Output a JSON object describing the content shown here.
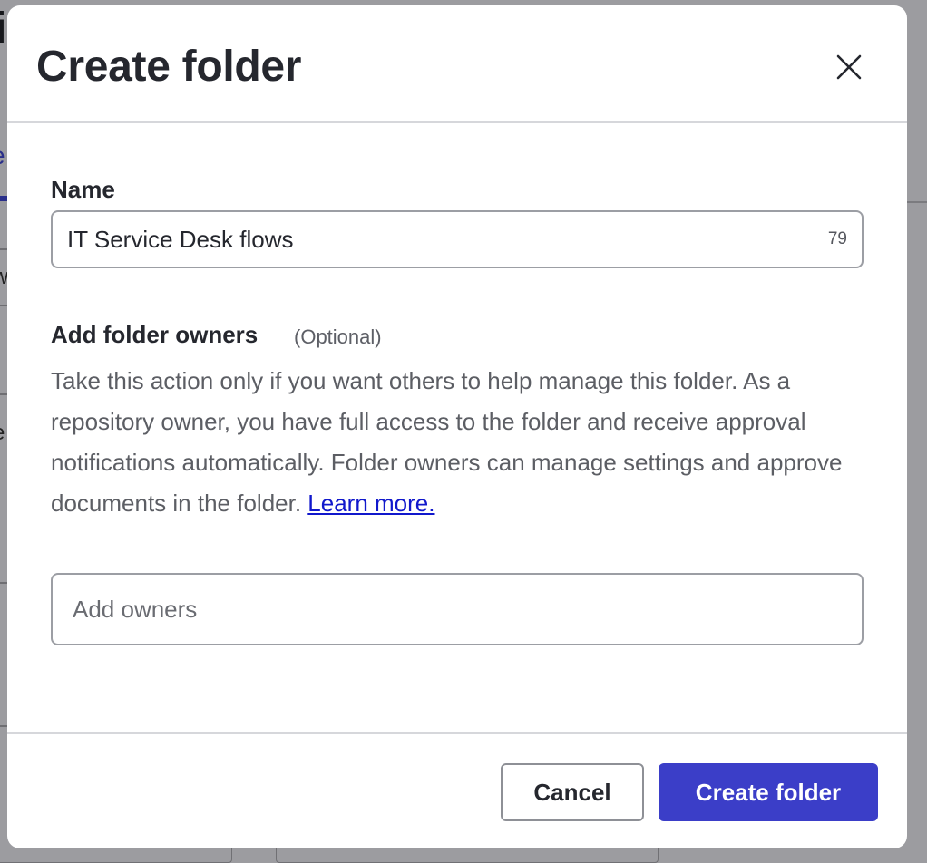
{
  "modal": {
    "title": "Create folder",
    "close_icon": "close-icon"
  },
  "name_field": {
    "label": "Name",
    "value": "IT Service Desk flows",
    "char_counter": "79"
  },
  "owners_field": {
    "label": "Add folder owners",
    "optional": "(Optional)",
    "description": "Take this action only if you want others to help manage this folder. As a repository owner, you have full access to the folder and receive approval notifications automatically. Folder owners can manage settings and approve documents in the folder.",
    "learn_more": "Learn more.",
    "placeholder": "Add owners"
  },
  "footer": {
    "cancel_label": "Cancel",
    "create_label": "Create folder"
  },
  "colors": {
    "primary": "#3b3ec8",
    "link": "#1118cc",
    "overlay": "#9c9ca0"
  }
}
